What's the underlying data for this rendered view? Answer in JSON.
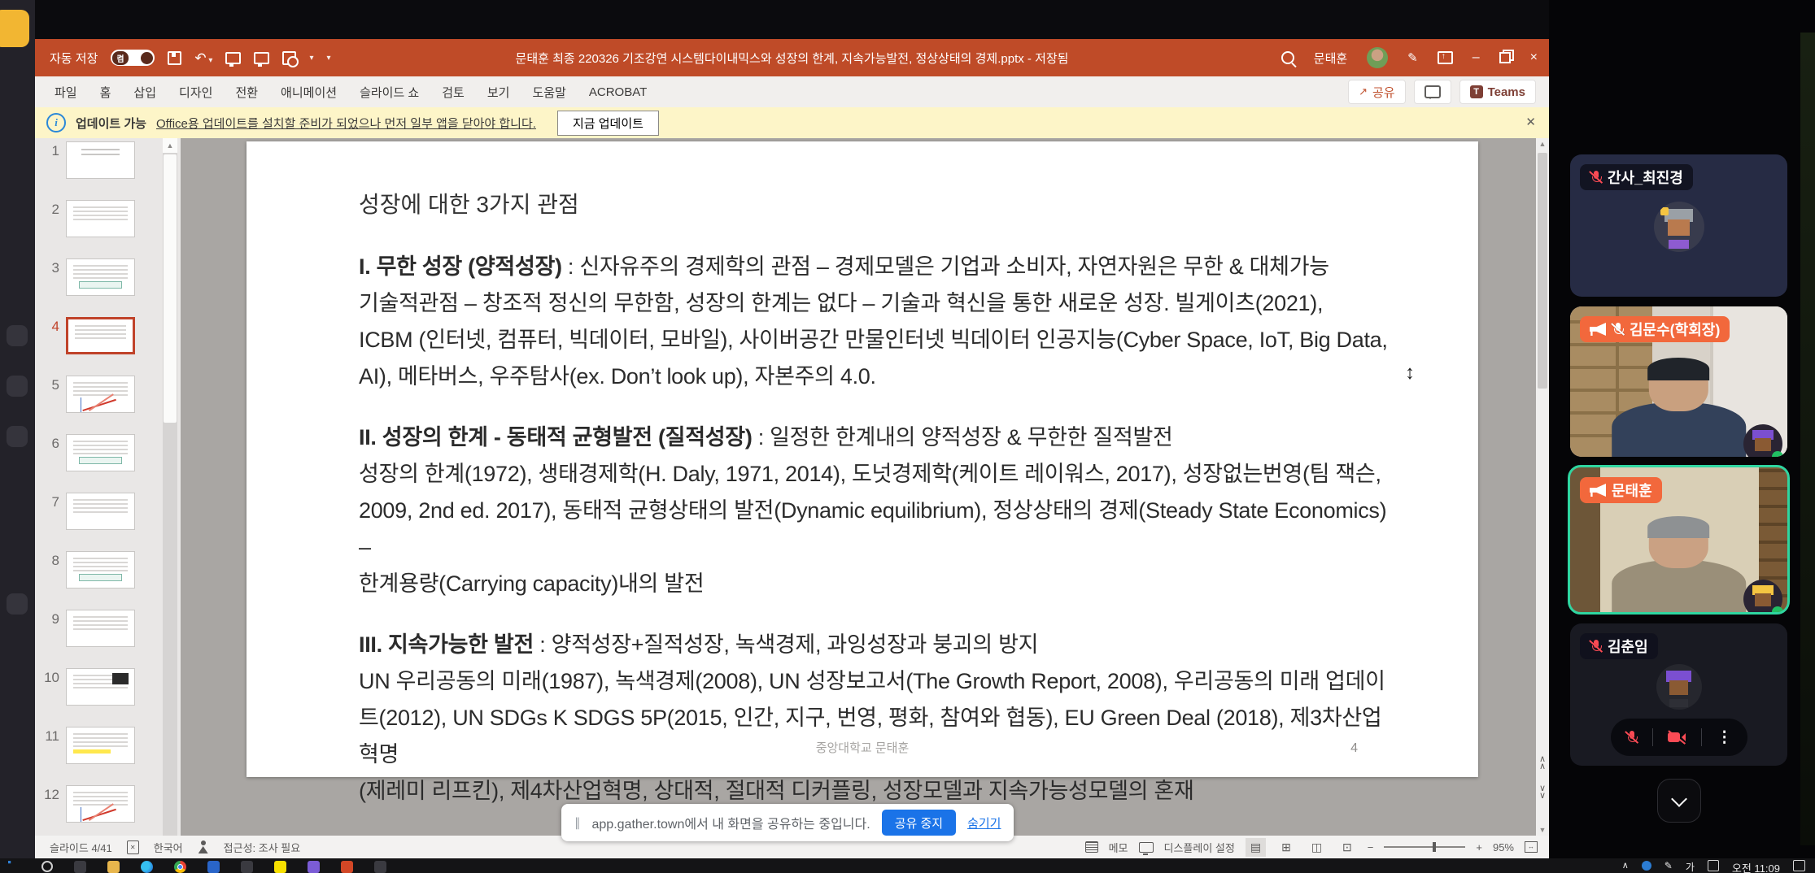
{
  "colors": {
    "accent": "#c0432a",
    "titlebar": "#bf4b28",
    "update-yellow": "#fdf5c8",
    "share-blue": "#1a73e8",
    "label-orange": "#f2683c",
    "speaking-green": "#2fd6a0"
  },
  "titlebar": {
    "autosave_label": "자동 저장",
    "autosave_state": "켬",
    "title": "문태훈 최종 220326 기조강연 시스템다이내믹스와 성장의 한계, 지속가능발전, 정상상태의 경제.pptx - 저장됨",
    "user_name": "문태훈"
  },
  "ribbon": {
    "tabs": [
      "파일",
      "홈",
      "삽입",
      "디자인",
      "전환",
      "애니메이션",
      "슬라이드 쇼",
      "검토",
      "보기",
      "도움말",
      "ACROBAT"
    ],
    "share": "공유",
    "teams": "Teams"
  },
  "update_bar": {
    "title": "업데이트 가능",
    "message": "Office용 업데이트를 설치할 준비가 되었으나 먼저 일부 앱을 닫아야 합니다.",
    "button": "지금 업데이트"
  },
  "thumbnails": {
    "selected": 4,
    "items": [
      {
        "n": 1,
        "kind": "title"
      },
      {
        "n": 2,
        "kind": "text"
      },
      {
        "n": 3,
        "kind": "box"
      },
      {
        "n": 4,
        "kind": "text"
      },
      {
        "n": 5,
        "kind": "chart"
      },
      {
        "n": 6,
        "kind": "box"
      },
      {
        "n": 7,
        "kind": "text"
      },
      {
        "n": 8,
        "kind": "box"
      },
      {
        "n": 9,
        "kind": "text"
      },
      {
        "n": 10,
        "kind": "image"
      },
      {
        "n": 11,
        "kind": "highlight"
      },
      {
        "n": 12,
        "kind": "chart"
      }
    ]
  },
  "slide": {
    "title": "성장에 대한 3가지 관점",
    "sections": [
      {
        "heading": "I. 무한 성장 (양적성장)",
        "rest": " : 신자유주의 경제학의 관점 – 경제모델은 기업과 소비자, 자연자원은 무한 & 대체가능",
        "lines": [
          "기술적관점 – 창조적 정신의 무한함, 성장의 한계는 없다 – 기술과 혁신을 통한 새로운 성장. 빌게이츠(2021),",
          "ICBM (인터넷, 컴퓨터, 빅데이터, 모바일), 사이버공간 만물인터넷 빅데이터 인공지능(Cyber Space, IoT, Big Data,",
          "AI), 메타버스, 우주탐사(ex. Don’t look up), 자본주의 4.0."
        ]
      },
      {
        "heading": "II. 성장의 한계 - 동태적 균형발전 (질적성장)",
        "rest": " : 일정한 한계내의 양적성장 & 무한한 질적발전",
        "lines": [
          "성장의 한계(1972), 생태경제학(H. Daly, 1971, 2014), 도넛경제학(케이트 레이워스, 2017), 성장없는번영(팀 잭슨,",
          "2009, 2nd ed. 2017), 동태적 균형상태의 발전(Dynamic equilibrium), 정상상태의 경제(Steady State Economics) –",
          "한계용량(Carrying capacity)내의 발전"
        ]
      },
      {
        "heading": "III. 지속가능한 발전",
        "rest": " : 양적성장+질적성장,  녹색경제, 과잉성장과 붕괴의 방지",
        "lines": [
          "UN 우리공동의 미래(1987), 녹색경제(2008), UN 성장보고서(The Growth Report, 2008), 우리공동의 미래 업데이",
          "트(2012), UN SDGs K SDGS 5P(2015, 인간, 지구, 번영, 평화, 참여와 협동), EU Green Deal (2018), 제3차산업혁명",
          "(제레미 리프킨), 제4차산업혁명, 상대적, 절대적 디커플링, 성장모델과 지속가능성모델의 혼재"
        ]
      }
    ],
    "footer": "중앙대학교 문태훈",
    "page": "4"
  },
  "status": {
    "slide_indicator": "슬라이드 4/41",
    "language": "한국어",
    "accessibility": "접근성: 조사 필요",
    "notes": "메모",
    "display_settings": "디스플레이 설정",
    "zoom": "95%"
  },
  "share_banner": {
    "message": "app.gather.town에서 내 화면을 공유하는 중입니다.",
    "stop": "공유 중지",
    "hide": "숨기기"
  },
  "participants": {
    "list": [
      {
        "name": "간사_최진경"
      },
      {
        "name": "김문수(학회장)"
      },
      {
        "name": "문태훈"
      },
      {
        "name": "김춘임"
      }
    ]
  },
  "taskbar": {
    "ime": "가",
    "time": "오전 11:09"
  }
}
